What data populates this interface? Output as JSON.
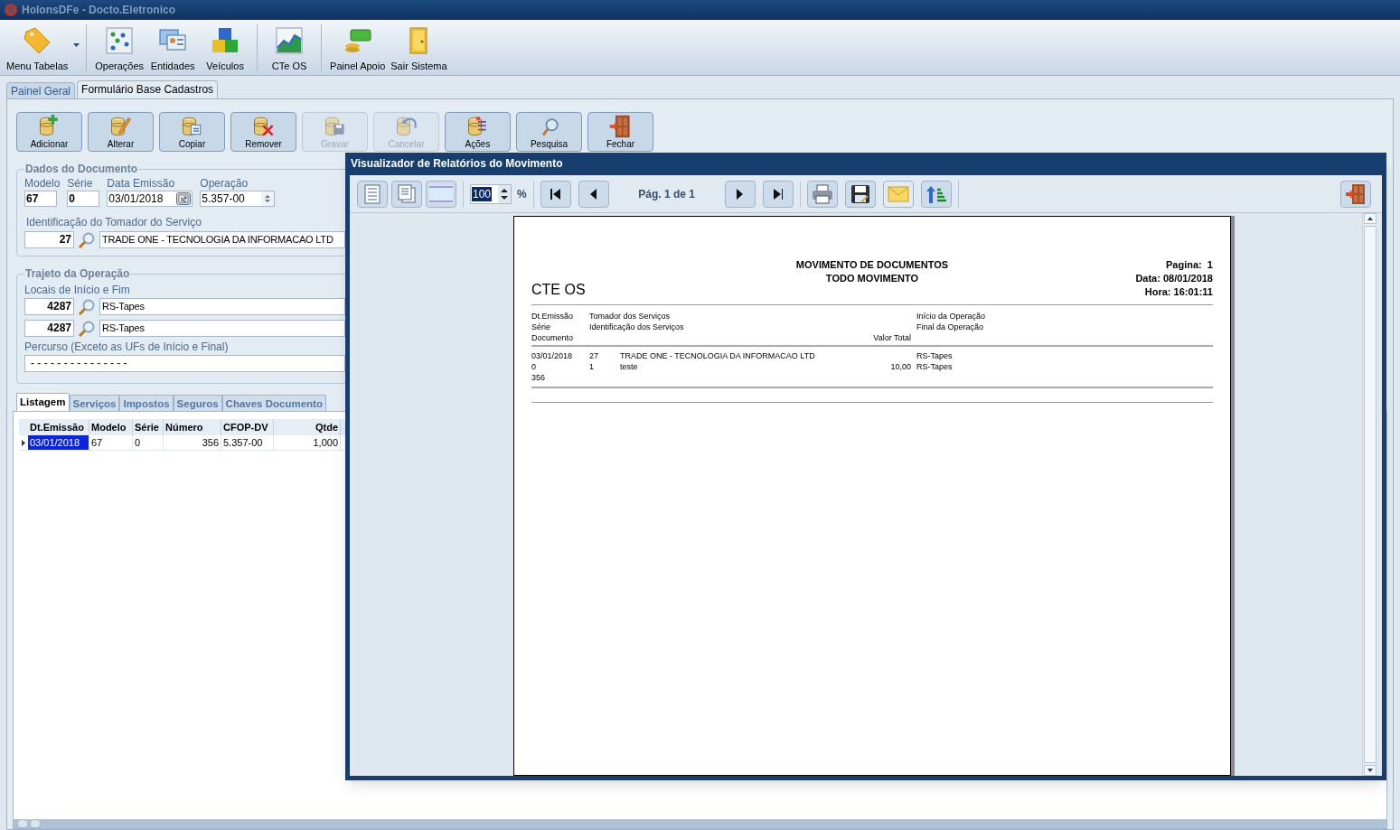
{
  "window": {
    "title": "HolonsDFe - Docto.Eletronico"
  },
  "main_toolbar": [
    {
      "label": "Menu Tabelas",
      "kind": "tag",
      "dropdown": true
    },
    {
      "label": "Operações",
      "kind": "grid",
      "dropdown": false
    },
    {
      "label": "Entidades",
      "kind": "cards",
      "dropdown": false
    },
    {
      "label": "Veículos",
      "kind": "cubes",
      "dropdown": false
    },
    {
      "label": "CTe OS",
      "kind": "chart",
      "dropdown": false
    },
    {
      "label": "Painel Apoio",
      "kind": "money",
      "dropdown": false
    },
    {
      "label": "Sair Sistema",
      "kind": "door",
      "dropdown": false
    }
  ],
  "page_tabs": [
    {
      "label": "Painel Geral",
      "selected": false
    },
    {
      "label": "Formulário Base Cadastros",
      "selected": true
    }
  ],
  "actions": [
    {
      "label": "Adicionar",
      "kind": "add",
      "disabled": false
    },
    {
      "label": "Alterar",
      "kind": "edit",
      "disabled": false
    },
    {
      "label": "Copiar",
      "kind": "copy",
      "disabled": false
    },
    {
      "label": "Remover",
      "kind": "remove",
      "disabled": false
    },
    {
      "label": "Gravar",
      "kind": "save",
      "disabled": true
    },
    {
      "label": "Cancelar",
      "kind": "undo",
      "disabled": true
    },
    {
      "label": "Ações",
      "kind": "list",
      "disabled": false
    },
    {
      "label": "Pesquisa",
      "kind": "search",
      "disabled": false
    },
    {
      "label": "Fechar",
      "kind": "exit",
      "disabled": false
    }
  ],
  "document_data": {
    "title": "Dados do Documento",
    "fields": [
      {
        "label": "Modelo",
        "value": "67",
        "kind": "bold"
      },
      {
        "label": "Série",
        "value": "0",
        "kind": "bold"
      },
      {
        "label": "Data Emissão",
        "value": "03/01/2018",
        "kind": "date"
      },
      {
        "label": "Operação",
        "value": "5.357-00",
        "kind": "spin"
      }
    ],
    "tomador": {
      "label": "Identificação do Tomador do Serviço",
      "code": "27",
      "name": "TRADE ONE - TECNOLOGIA DA INFORMACAO LTD"
    }
  },
  "route": {
    "title": "Trajeto da Operação",
    "label": "Locais de Início e Fim",
    "places": [
      {
        "code": "4287",
        "name": "RS-Tapes"
      },
      {
        "code": "4287",
        "name": "RS-Tapes"
      }
    ],
    "percurso_label": "Percurso (Exceto as UFs de Início e Final)",
    "percurso_value": "- - - - - - - - - - - - - - -"
  },
  "detail_tabs": [
    {
      "label": "Listagem",
      "selected": true
    },
    {
      "label": "Serviços",
      "selected": false
    },
    {
      "label": "Impostos",
      "selected": false
    },
    {
      "label": "Seguros",
      "selected": false
    },
    {
      "label": "Chaves Documento",
      "selected": false
    }
  ],
  "grid": {
    "columns": [
      "Dt.Emissão",
      "Modelo",
      "Série",
      "Número",
      "CFOP-DV",
      "Qtde"
    ],
    "rows": [
      {
        "cells": [
          "03/01/2018",
          "67",
          "0",
          "356",
          "5.357-00",
          "1,000"
        ],
        "selected": true
      }
    ]
  },
  "report_viewer": {
    "title": "Visualizador de Relatórios do Movimento",
    "zoom": "100",
    "percent": "%",
    "page_label": "Pág. 1 de 1",
    "report": {
      "title": "MOVIMENTO DE DOCUMENTOS",
      "subtitle": "TODO MOVIMENTO",
      "name": "CTE OS",
      "page": "Pagina:  1",
      "date": "Data: 08/01/2018",
      "time": "Hora: 16:01:11",
      "headers": [
        [
          "Dt.Emissão",
          "Série",
          "Documento"
        ],
        [
          "Tomador dos Serviços",
          "Identificação dos Serviços"
        ],
        [
          "Valor Total"
        ],
        [
          "Início da Operação",
          "Final da Operação"
        ]
      ],
      "records": [
        {
          "doc": [
            "03/01/2018",
            "0",
            "356"
          ],
          "ids": [
            "27",
            "1"
          ],
          "texts": [
            "TRADE ONE - TECNOLOGIA DA INFORMACAO LTD",
            "teste"
          ],
          "value": "10,00",
          "places": [
            "RS-Tapes",
            "RS-Tapes"
          ]
        }
      ]
    }
  }
}
